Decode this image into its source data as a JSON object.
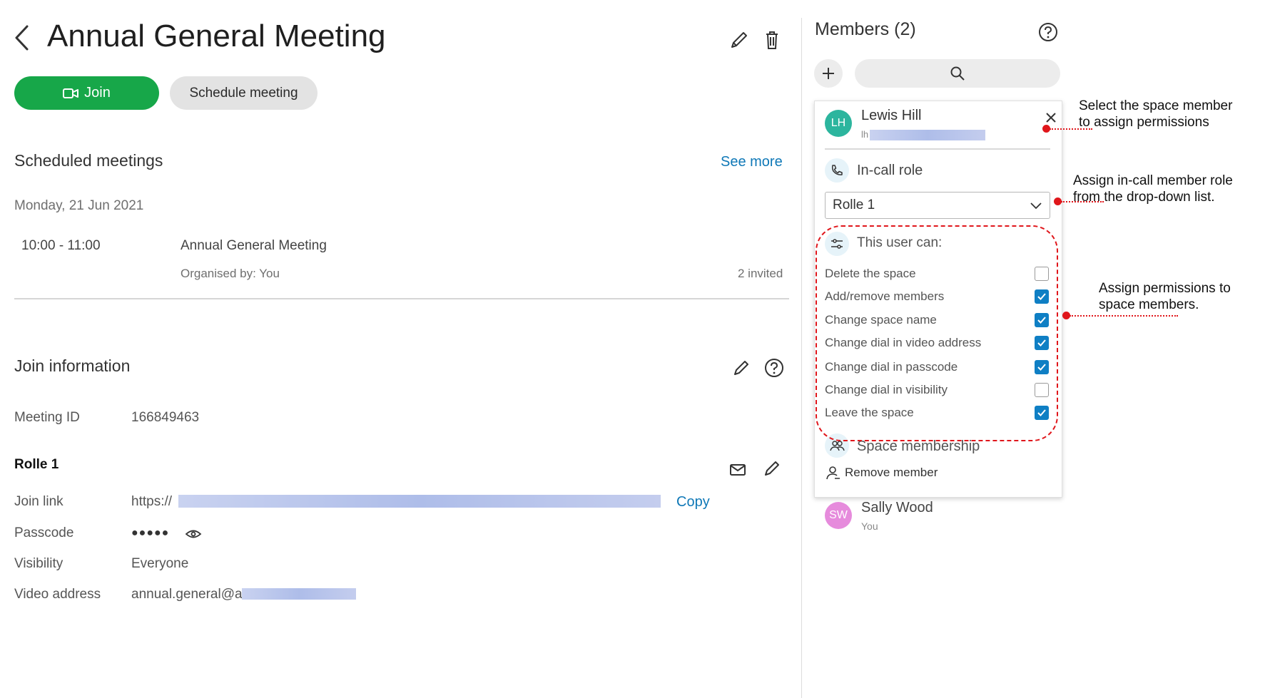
{
  "header": {
    "title": "Annual General Meeting"
  },
  "actions": {
    "join_label": "Join",
    "schedule_label": "Schedule meeting"
  },
  "scheduled": {
    "heading": "Scheduled meetings",
    "see_more": "See more",
    "date": "Monday, 21 Jun 2021",
    "meeting": {
      "time": "10:00 - 11:00",
      "title": "Annual General Meeting",
      "organiser": "Organised by: You",
      "invited": "2 invited"
    }
  },
  "join_info": {
    "heading": "Join information",
    "meeting_id_label": "Meeting ID",
    "meeting_id": "166849463",
    "role_heading": "Rolle 1",
    "join_link_label": "Join link",
    "join_link_prefix": "https://",
    "copy": "Copy",
    "passcode_label": "Passcode",
    "passcode_mask": "●●●●●",
    "visibility_label": "Visibility",
    "visibility_value": "Everyone",
    "video_address_label": "Video address",
    "video_address_prefix": "annual.general@a"
  },
  "members": {
    "title": "Members (2)",
    "selected": {
      "name": "Lewis Hill",
      "initials": "LH",
      "email_prefix": "lh",
      "avatar_color": "#2cb59e"
    },
    "incall_role_label": "In-call role",
    "role_value": "Rolle 1",
    "permissions_heading": "This user can:",
    "permissions": [
      {
        "label": "Delete the space",
        "checked": false
      },
      {
        "label": "Add/remove members",
        "checked": true
      },
      {
        "label": "Change space name",
        "checked": true
      },
      {
        "label": "Change dial in video address",
        "checked": true
      },
      {
        "label": "Change dial in passcode",
        "checked": true
      },
      {
        "label": "Change dial in visibility",
        "checked": false
      },
      {
        "label": "Leave the space",
        "checked": true
      }
    ],
    "space_membership_label": "Space membership",
    "remove_member_label": "Remove member",
    "other": {
      "name": "Sally Wood",
      "initials": "SW",
      "subtitle": "You",
      "avatar_color": "#e68bdc"
    }
  },
  "annotations": {
    "select_member": [
      "Select the space member",
      "to assign permissions"
    ],
    "assign_role": [
      "Assign in-call member role",
      "from the drop-down list."
    ],
    "assign_permissions": [
      "Assign permissions to",
      "space members."
    ],
    "color": "#e0161b"
  },
  "colors": {
    "accent_green": "#17a749",
    "link_blue": "#0f78b7",
    "checkbox_blue": "#0f7fc4"
  }
}
